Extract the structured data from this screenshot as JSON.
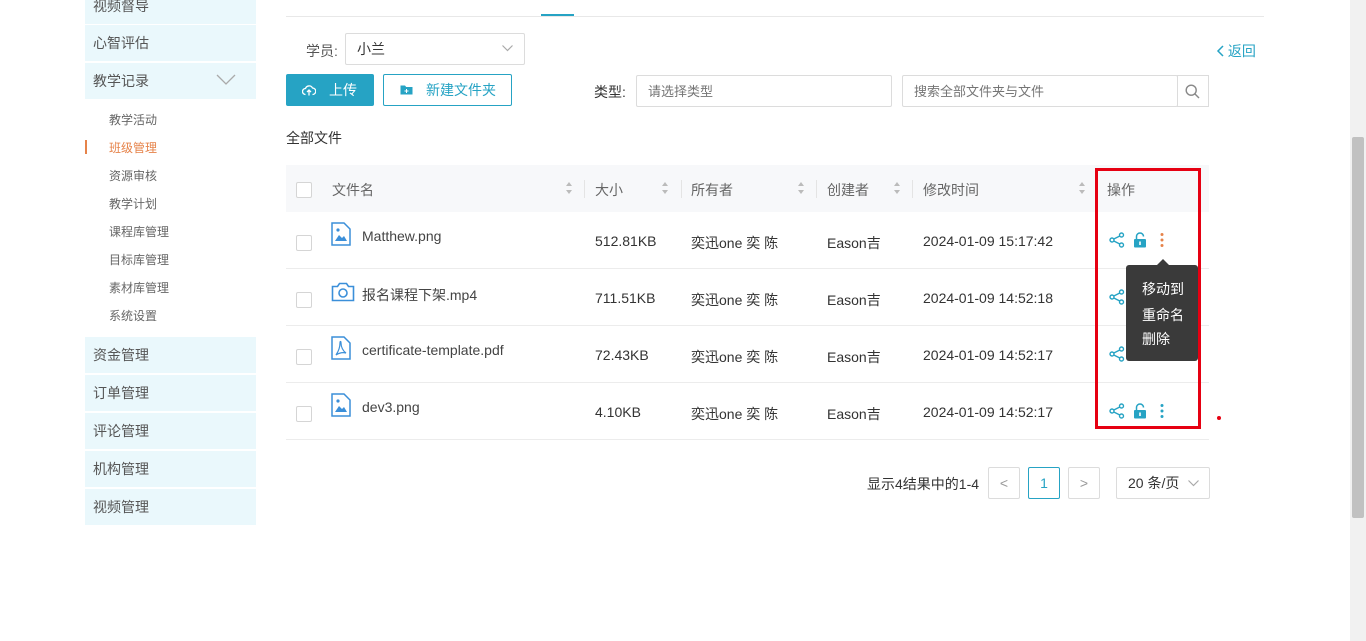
{
  "sidebar": {
    "top_items": [
      "视频督导",
      "心智评估"
    ],
    "expanded": {
      "label": "教学记录",
      "icon": "chevron-down-icon"
    },
    "sub_items": [
      {
        "label": "教学活动",
        "active": false
      },
      {
        "label": "班级管理",
        "active": true
      },
      {
        "label": "资源审核",
        "active": false
      },
      {
        "label": "教学计划",
        "active": false
      },
      {
        "label": "课程库管理",
        "active": false
      },
      {
        "label": "目标库管理",
        "active": false
      },
      {
        "label": "素材库管理",
        "active": false
      },
      {
        "label": "系统设置",
        "active": false
      }
    ],
    "bottom_items": [
      "资金管理",
      "订单管理",
      "评论管理",
      "机构管理",
      "视频管理"
    ],
    "accent": "#e6834a"
  },
  "filters": {
    "student_label": "学员:",
    "student_value": "小兰",
    "back_label": "返回",
    "upload_label": "上传",
    "new_folder_label": "新建文件夹",
    "type_label": "类型:",
    "type_placeholder": "请选择类型",
    "search_placeholder": "搜索全部文件夹与文件"
  },
  "section_title": "全部文件",
  "table": {
    "columns": [
      "文件名",
      "大小",
      "所有者",
      "创建者",
      "修改时间",
      "操作"
    ],
    "rows": [
      {
        "name": "Matthew.png",
        "icon": "image-file-icon",
        "size": "512.81KB",
        "owner": "奕迅one 奕 陈",
        "creator": "Eason吉",
        "modified": "2024-01-09 15:17:42"
      },
      {
        "name": "报名课程下架.mp4",
        "icon": "video-file-icon",
        "size": "711.51KB",
        "owner": "奕迅one 奕 陈",
        "creator": "Eason吉",
        "modified": "2024-01-09 14:52:18"
      },
      {
        "name": "certificate-template.pdf",
        "icon": "pdf-file-icon",
        "size": "72.43KB",
        "owner": "奕迅one 奕 陈",
        "creator": "Eason吉",
        "modified": "2024-01-09 14:52:17"
      },
      {
        "name": "dev3.png",
        "icon": "image-file-icon",
        "size": "4.10KB",
        "owner": "奕迅one 奕 陈",
        "creator": "Eason吉",
        "modified": "2024-01-09 14:52:17"
      }
    ]
  },
  "dropdown_menu": [
    "移动到",
    "重命名",
    "删除"
  ],
  "pagination": {
    "summary": "显示4结果中的1-4",
    "current_page": "1",
    "page_size": "20 条/页",
    "prev": "<",
    "next": ">"
  },
  "colors": {
    "primary": "#26a3c4",
    "highlight": "#e60012",
    "nav_bg": "#eaf8fc"
  }
}
